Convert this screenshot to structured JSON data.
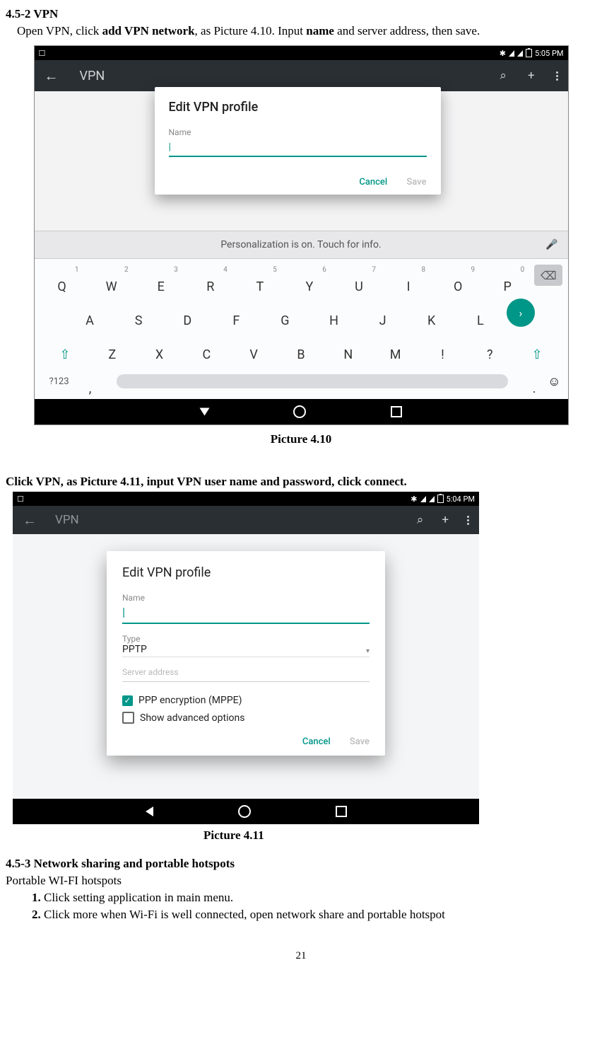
{
  "doc": {
    "h_452": "4.5-2 VPN",
    "p_open_pre": "Open VPN, click ",
    "p_open_b1": "add VPN network",
    "p_open_mid": ", as Picture 4.10. Input ",
    "p_open_b2": "name",
    "p_open_post": " and server address, then save.",
    "caption_410": "Picture 4.10",
    "p_click": "Click VPN, as Picture 4.11, input VPN user name and password, click connect.",
    "caption_411": "Picture 4.11",
    "h_453": "4.5-3 Network sharing and portable hotspots",
    "p_portable": "Portable WI-FI hotspots",
    "step1_num": "1.",
    "step1": "Click setting application in main menu.",
    "step2_num": "2.",
    "step2": "Click more when Wi-Fi is well connected, open network share and portable hotspot",
    "page_no": "21"
  },
  "fig410": {
    "status_left": "☐",
    "time": "5:05 PM",
    "appbar_title": "VPN",
    "dialog_title": "Edit VPN profile",
    "field_name_label": "Name",
    "field_cursor": "|",
    "btn_cancel": "Cancel",
    "btn_save": "Save",
    "suggest": "Personalization is on. Touch for info.",
    "row1": [
      "Q",
      "W",
      "E",
      "R",
      "T",
      "Y",
      "U",
      "I",
      "O",
      "P"
    ],
    "row1_sup": [
      "1",
      "2",
      "3",
      "4",
      "5",
      "6",
      "7",
      "8",
      "9",
      "0"
    ],
    "row2": [
      "A",
      "S",
      "D",
      "F",
      "G",
      "H",
      "J",
      "K",
      "L"
    ],
    "row3": [
      "Z",
      "X",
      "C",
      "V",
      "B",
      "N",
      "M",
      "!",
      "?"
    ],
    "key123": "?123",
    "comma": ",",
    "period": "."
  },
  "fig411": {
    "time": "5:04 PM",
    "appbar_title": "VPN",
    "dialog_title": "Edit VPN profile",
    "label_name": "Name",
    "label_type": "Type",
    "val_type": "PPTP",
    "label_server": "Server address",
    "chk_ppp": "PPP encryption (MPPE)",
    "chk_adv": "Show advanced options",
    "btn_cancel": "Cancel",
    "btn_save": "Save"
  }
}
